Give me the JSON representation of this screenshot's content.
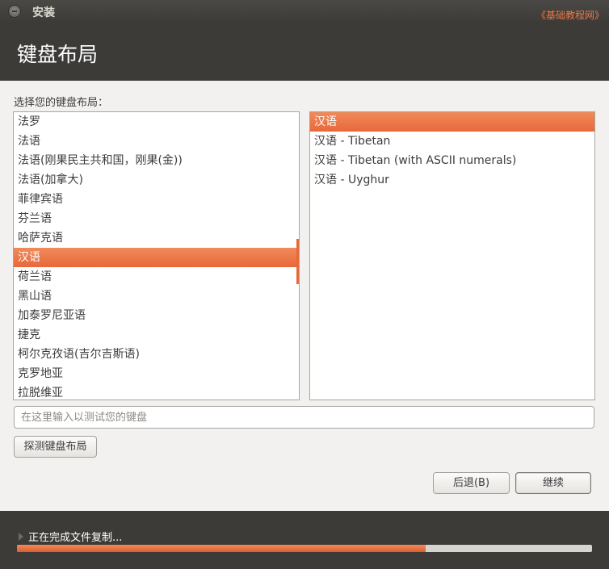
{
  "window": {
    "title": "安装",
    "watermark": "《基础教程网》"
  },
  "header": {
    "title": "键盘布局"
  },
  "main": {
    "prompt": "选择您的键盘布局：",
    "layouts": [
      "法罗",
      "法语",
      "法语(刚果民主共和国，刚果(金))",
      "法语(加拿大)",
      "菲律宾语",
      "芬兰语",
      "哈萨克语",
      "汉语",
      "荷兰语",
      "黑山语",
      "加泰罗尼亚语",
      "捷克",
      "柯尔克孜语(吉尔吉斯语)",
      "克罗地亚",
      "拉脱维亚"
    ],
    "layouts_selected_index": 7,
    "variants": [
      "汉语",
      "汉语 - Tibetan",
      "汉语 - Tibetan (with ASCII numerals)",
      "汉语 - Uyghur"
    ],
    "variants_selected_index": 0,
    "test_input": {
      "value": "",
      "placeholder": "在这里输入以测试您的键盘"
    },
    "detect_button": "探测键盘布局",
    "back_button": "后退(B)",
    "continue_button": "继续"
  },
  "status": {
    "text": "正在完成文件复制...",
    "progress": 0.71
  },
  "colors": {
    "accent": "#e8683a",
    "dark_bg": "#3c3b37",
    "window_bg": "#f2f1f0"
  }
}
